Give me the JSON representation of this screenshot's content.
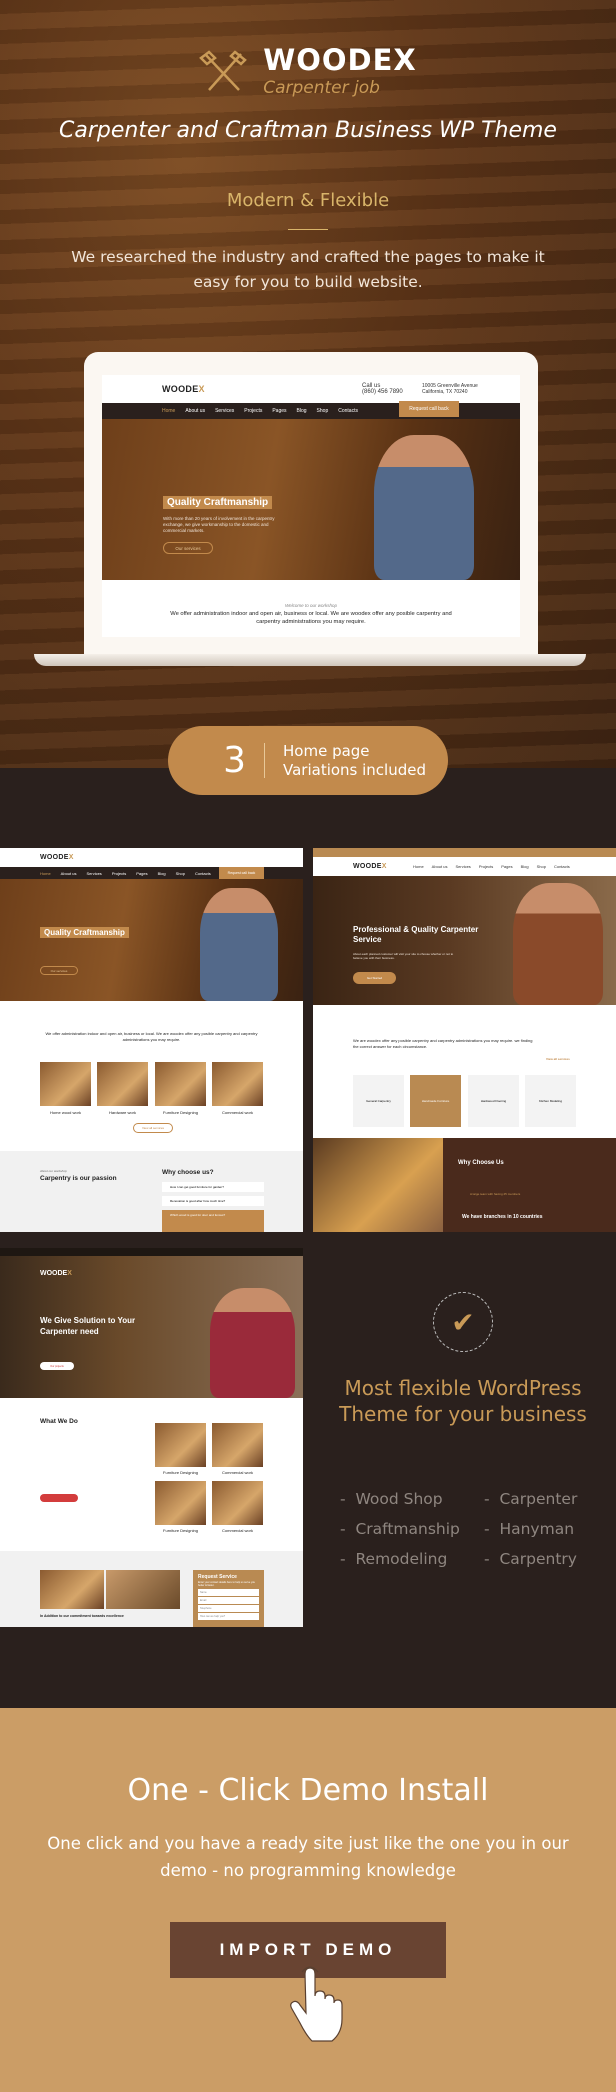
{
  "brand": {
    "name": "WOODEX",
    "sub": "Carpenter job"
  },
  "hero": {
    "tagline": "Carpenter and Craftman Business WP Theme",
    "subtitle": "Modern & Flexible",
    "intro": "We researched the industry and crafted the pages to make it easy for you to build website."
  },
  "laptop": {
    "call_label": "Call us",
    "phone": "(860) 456 7890",
    "address1": "10005 Greenville Avenue",
    "address2": "California, TX 70240",
    "nav": [
      "Home",
      "About us",
      "Services",
      "Projects",
      "Pages",
      "Blog",
      "Shop",
      "Contacts"
    ],
    "request": "Request call back",
    "hero_title": "Quality Craftmanship",
    "hero_text": "With more than 20 years of involvement in the carpentry exchange, we give workmanship to the domestic and commercial markets.",
    "hero_btn": "Our services",
    "welcome": "Welcome to our workshop",
    "welcome_text": "We offer administration indoor and open air, business or local. We are woodex offer any posible carpentry and carpentry administrations you may require."
  },
  "variations": {
    "count": "3",
    "line1": "Home page",
    "line2": "Variations included"
  },
  "thumb1": {
    "services": [
      "Home wood work",
      "Hardware work",
      "Furniture Designing",
      "Commercial work"
    ],
    "view_all": "View all services",
    "about_small": "About our workshop",
    "about_title": "Carpentry is our passion",
    "why": "Why choose us?",
    "faq": [
      "How I can get good furniture for garden?",
      "Renovation is good after how much time?",
      "Which wood is good for door and fences?"
    ]
  },
  "thumb2": {
    "hero_title": "Professional & Quality Carpenter Service",
    "hero_text": "About each planned customer will visit your site to choose whether or not to believe you with their business.",
    "hero_btn": "Get Started",
    "lead": "We are woodex offer any posible carpentry and carpentry administrations you may require. we finding the correct answer for each circumstance.",
    "view_all": "View all services",
    "services": [
      "General Carpentry",
      "Handmade Furniture",
      "Hardwood Flooring",
      "Kitchen Modeling"
    ],
    "why": "Why Choose Us",
    "bullets": [
      "A large team with having 25 members",
      "We have branches in 10 countries"
    ]
  },
  "thumb3": {
    "hero_title": "We Give Solution to Your Carpenter need",
    "hero_btn": "Our projects",
    "what": "What We Do",
    "services": [
      "Furniture Designing",
      "Commercial work",
      "Furniture Designing",
      "Commercial work"
    ],
    "addition": "In Addition to our commitment towards excellence",
    "request": "Request Service",
    "request_text": "Enter your contact details here to help us serve you better & faster.",
    "fields": [
      "Name",
      "Email",
      "Telephone",
      "How can we help you?"
    ]
  },
  "features": {
    "headline": "Most flexible WordPress Theme for your business",
    "items": [
      "Wood Shop",
      "Carpenter",
      "Craftmanship",
      "Hanyman",
      "Remodeling",
      "Carpentry"
    ]
  },
  "cta": {
    "title": "One - Click Demo Install",
    "text": "One click and you have a ready site just like the one you in our demo - no programming knowledge",
    "button": "IMPORT DEMO"
  },
  "colors": {
    "accent": "#c28a4c",
    "dark": "#2a201d",
    "cta_bg": "#cb9d66",
    "button": "#694432"
  }
}
